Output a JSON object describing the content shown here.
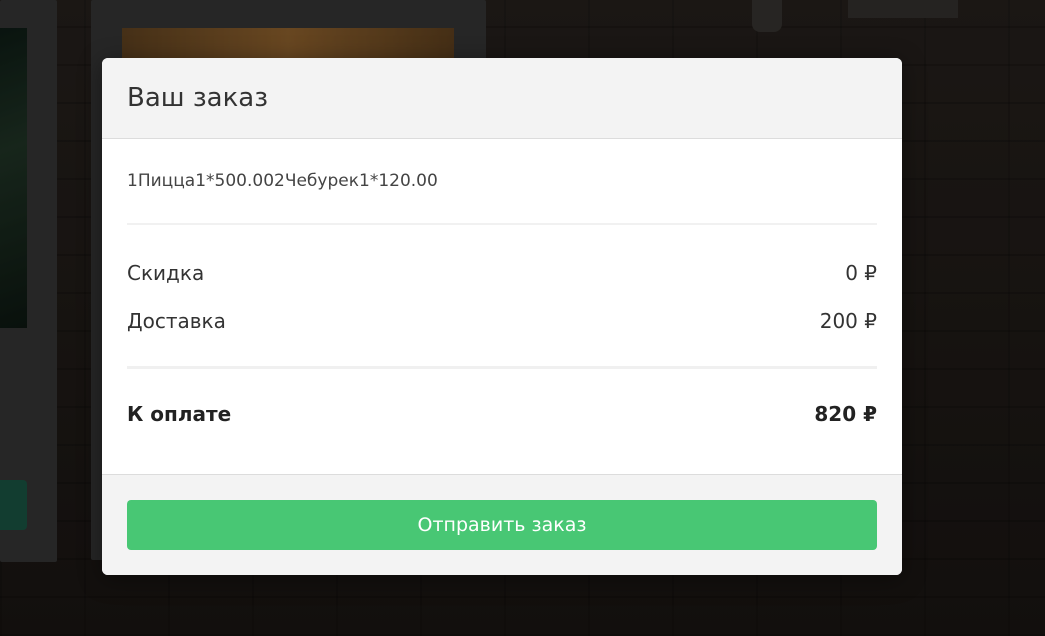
{
  "modal": {
    "title": "Ваш заказ",
    "order_items": "1Пицца1*500.002Чебурек1*120.00",
    "discount": {
      "label": "Скидка",
      "value": "0 ₽"
    },
    "delivery": {
      "label": "Доставка",
      "value": "200 ₽"
    },
    "total": {
      "label": "К оплате",
      "value": "820 ₽"
    },
    "submit_label": "Отправить заказ"
  },
  "colors": {
    "accent": "#48c774",
    "header_bg": "#f3f3f3"
  }
}
